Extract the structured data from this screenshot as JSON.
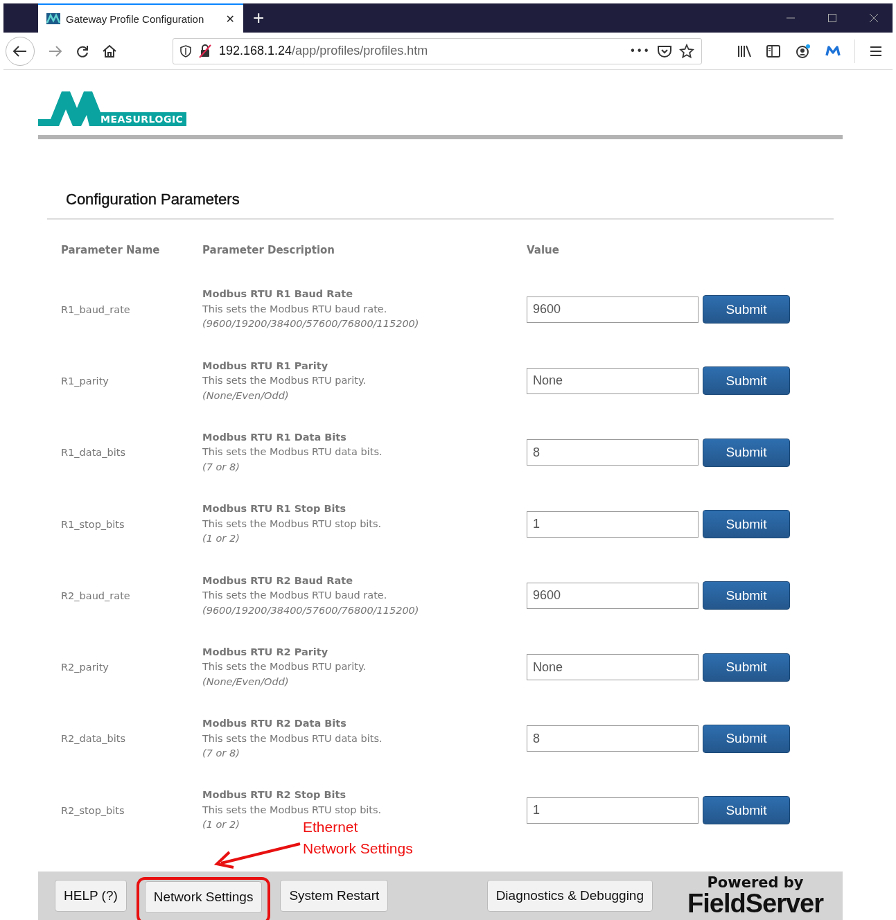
{
  "browser": {
    "tab_title": "Gateway Profile Configuration",
    "tab_close": "✕",
    "new_tab": "+",
    "url_host": "192.168.1.24",
    "url_path": "/app/profiles/profiles.htm",
    "page_actions": "•••"
  },
  "logo": {
    "text": "MEASURLOGIC"
  },
  "section": {
    "title": "Configuration Parameters"
  },
  "table": {
    "columns": [
      "Parameter Name",
      "Parameter Description",
      "Value"
    ],
    "rows": [
      {
        "name": "R1_baud_rate",
        "title": "Modbus RTU R1 Baud Rate",
        "description": "This sets the Modbus RTU baud rate.",
        "options": "(9600/19200/38400/57600/76800/115200)",
        "value": "9600",
        "button": "Submit"
      },
      {
        "name": "R1_parity",
        "title": "Modbus RTU R1 Parity",
        "description": "This sets the Modbus RTU parity.",
        "options": "(None/Even/Odd)",
        "value": "None",
        "button": "Submit"
      },
      {
        "name": "R1_data_bits",
        "title": "Modbus RTU R1 Data Bits",
        "description": "This sets the Modbus RTU data bits.",
        "options": "(7 or 8)",
        "value": "8",
        "button": "Submit"
      },
      {
        "name": "R1_stop_bits",
        "title": "Modbus RTU R1 Stop Bits",
        "description": "This sets the Modbus RTU stop bits.",
        "options": "(1 or 2)",
        "value": "1",
        "button": "Submit"
      },
      {
        "name": "R2_baud_rate",
        "title": "Modbus RTU R2 Baud Rate",
        "description": "This sets the Modbus RTU baud rate.",
        "options": "(9600/19200/38400/57600/76800/115200)",
        "value": "9600",
        "button": "Submit"
      },
      {
        "name": "R2_parity",
        "title": "Modbus RTU R2 Parity",
        "description": "This sets the Modbus RTU parity.",
        "options": "(None/Even/Odd)",
        "value": "None",
        "button": "Submit"
      },
      {
        "name": "R2_data_bits",
        "title": "Modbus RTU R2 Data Bits",
        "description": "This sets the Modbus RTU data bits.",
        "options": "(7 or 8)",
        "value": "8",
        "button": "Submit"
      },
      {
        "name": "R2_stop_bits",
        "title": "Modbus RTU R2 Stop Bits",
        "description": "This sets the Modbus RTU stop bits.",
        "options": "(1 or 2)",
        "value": "1",
        "button": "Submit"
      }
    ]
  },
  "annotation": {
    "lines": [
      "Ethernet",
      "Network Settings"
    ]
  },
  "footer": {
    "buttons": [
      {
        "label": "HELP (?)",
        "highlighted": false
      },
      {
        "label": "Network Settings",
        "highlighted": true
      },
      {
        "label": "System Restart",
        "highlighted": false
      }
    ],
    "right_buttons": [
      {
        "label": "Diagnostics & Debugging",
        "highlighted": false
      }
    ],
    "powered_by": "Powered by",
    "brand": "FieldServer"
  }
}
